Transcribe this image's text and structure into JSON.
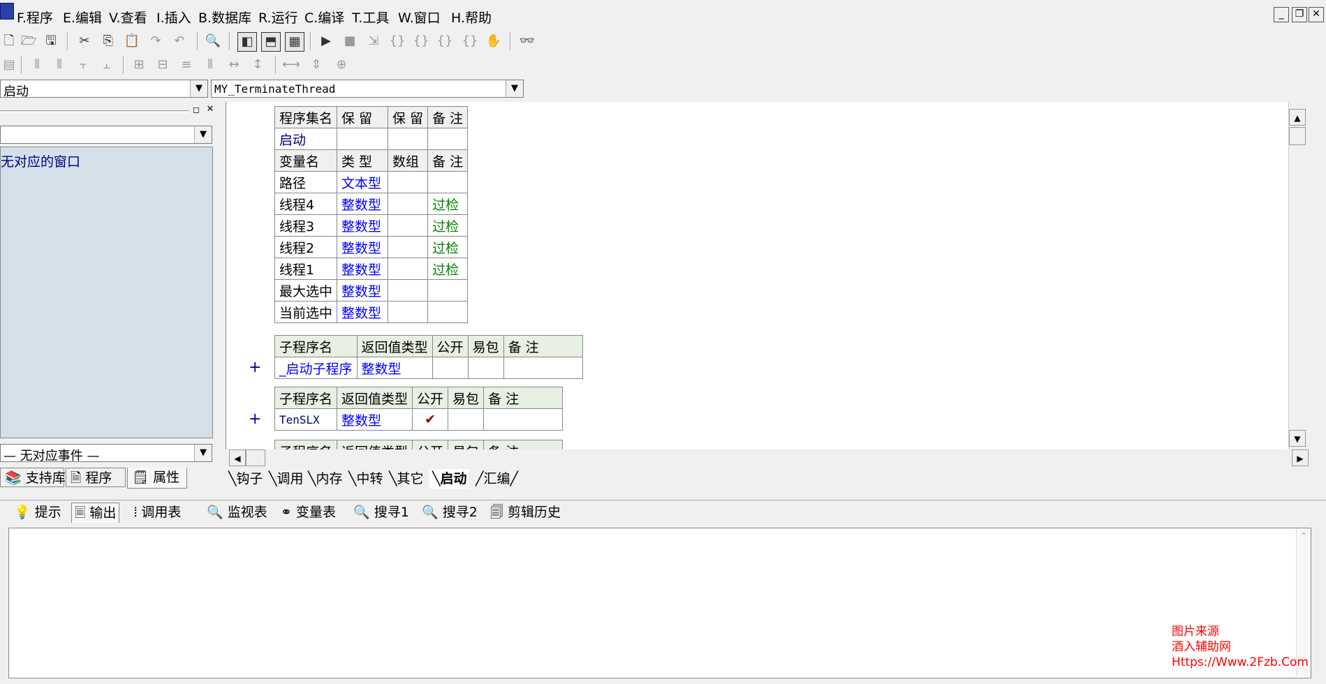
{
  "menu": {
    "items": [
      "F.程序",
      "E.编辑",
      "V.查看",
      "I.插入",
      "B.数据库",
      "R.运行",
      "C.编译",
      "T.工具",
      "W.窗口",
      "H.帮助"
    ],
    "min": "_",
    "restore": "❐",
    "close": "✕"
  },
  "combos": {
    "left_value": "启动",
    "right_value": "MY_TerminateThread",
    "panel_value": "",
    "event_value": "— 无对应事件 —"
  },
  "left_panel": {
    "list_item": "无对应的窗口",
    "tabs": [
      "支持库",
      "程序",
      "属性"
    ]
  },
  "tables": {
    "set_header": [
      "程序集名",
      "保 留",
      "保 留",
      "备 注"
    ],
    "set_row": [
      "启动",
      "",
      "",
      ""
    ],
    "var_header": [
      "变量名",
      "类 型",
      "数组",
      "备 注"
    ],
    "vars": [
      [
        "路径",
        "文本型",
        "",
        ""
      ],
      [
        "线程4",
        "整数型",
        "",
        "过检"
      ],
      [
        "线程3",
        "整数型",
        "",
        "过检"
      ],
      [
        "线程2",
        "整数型",
        "",
        "过检"
      ],
      [
        "线程1",
        "整数型",
        "",
        "过检"
      ],
      [
        "最大选中",
        "整数型",
        "",
        ""
      ],
      [
        "当前选中",
        "整数型",
        "",
        ""
      ]
    ],
    "sub_header": [
      "子程序名",
      "返回值类型",
      "公开",
      "易包",
      "备 注"
    ],
    "sub1": [
      "_启动子程序",
      "整数型",
      "",
      "",
      ""
    ],
    "sub2": [
      "TenSLX",
      "整数型",
      "✔",
      "",
      ""
    ],
    "partial": [
      "子程序名",
      "返回值类型",
      "公开",
      "易包",
      "备 注"
    ]
  },
  "code_tabs": [
    "钩子",
    "调用",
    "内存",
    "中转",
    "其它",
    "启动",
    "汇编"
  ],
  "active_code_tab": "启动",
  "output_tabs": [
    "提示",
    "输出",
    "调用表",
    "监视表",
    "变量表",
    "搜寻1",
    "搜寻2",
    "剪辑历史"
  ],
  "watermark": [
    "图片来源",
    "酒入辅助网",
    "Https://Www.2Fzb.Com"
  ]
}
